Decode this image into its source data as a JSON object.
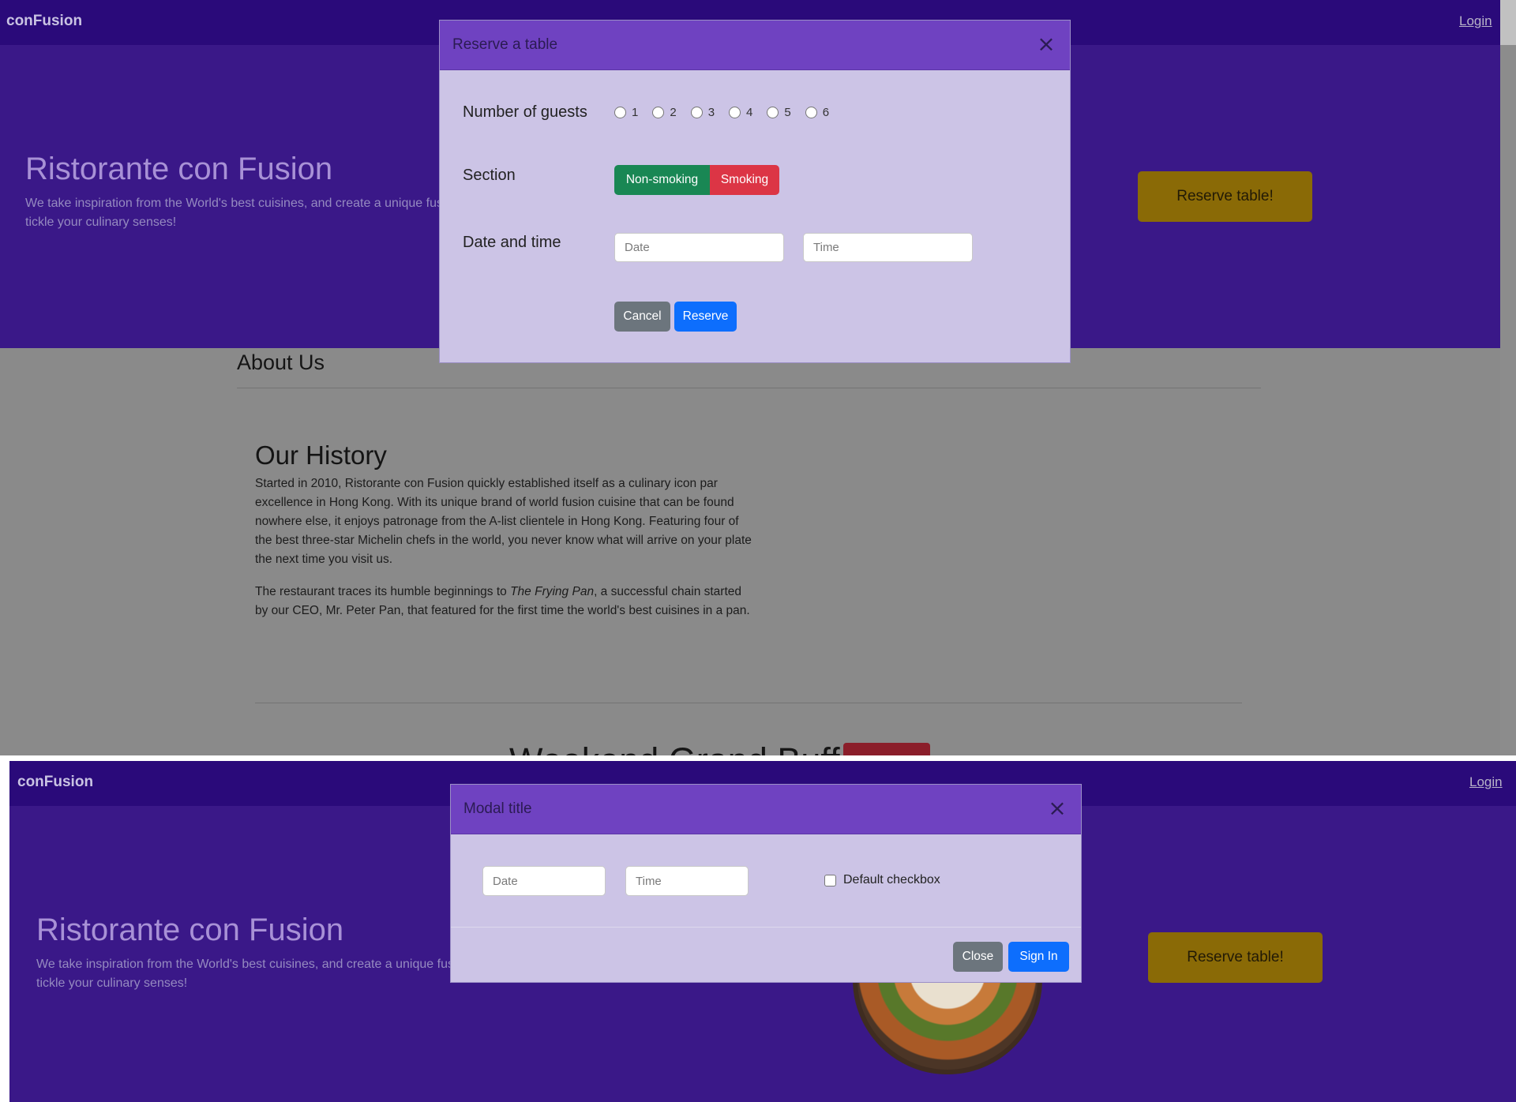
{
  "app": {
    "brand": "conFusion",
    "login": "Login",
    "hero_title": "Ristorante con Fusion",
    "hero_lead": "We take inspiration from the World's best cuisines, and create a unique fus tickle your culinary senses!",
    "reserve_button": "Reserve table!"
  },
  "screen1": {
    "about_title": "About Us",
    "history_title": "Our History",
    "history_p1": "Started in 2010, Ristorante con Fusion quickly established itself as a culinary icon par excellence in Hong Kong. With its unique brand of world fusion cuisine that can be found nowhere else, it enjoys patronage from the A-list clientele in Hong Kong. Featuring four of the best three-star Michelin chefs in the world, you never know what will arrive on your plate the next time you visit us.",
    "history_p2_prefix": "The restaurant traces its humble beginnings to ",
    "history_p2_em": "The Frying Pan",
    "history_p2_suffix": ", a successful chain started by our CEO, Mr. Peter Pan, that featured for the first time the world's best cuisines in a pan.",
    "weekend_title": "Weekend Grand Buffet",
    "modal": {
      "title": "Reserve a table",
      "guests_label": "Number of guests",
      "guest_options": [
        "1",
        "2",
        "3",
        "4",
        "5",
        "6"
      ],
      "section_label": "Section",
      "non_smoking": "Non-smoking",
      "smoking": "Smoking",
      "datetime_label": "Date and time",
      "date_placeholder": "Date",
      "time_placeholder": "Time",
      "cancel": "Cancel",
      "reserve": "Reserve"
    }
  },
  "screen2": {
    "modal": {
      "title": "Modal title",
      "date_placeholder": "Date",
      "time_placeholder": "Time",
      "checkbox_label": "Default checkbox",
      "close": "Close",
      "sign_in": "Sign In"
    }
  },
  "icons": {
    "close": "close-icon",
    "dish": "dish-image"
  },
  "colors": {
    "navbar": "#2a0a7a",
    "jumbotron": "#3a1888",
    "modal_header": "#6f42c1",
    "reserve_button": "#8a6a06",
    "success": "#198754",
    "danger": "#dc3545",
    "secondary": "#6c757d",
    "primary": "#0d6efd"
  }
}
